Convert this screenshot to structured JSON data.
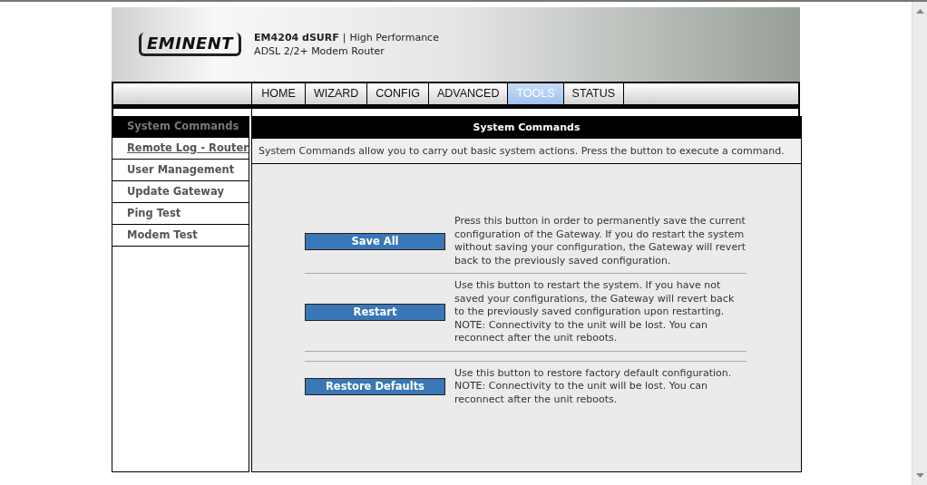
{
  "header": {
    "logo": "EMINENT",
    "product": "EM4204 dSURF",
    "separator": "|",
    "tagline": "High Performance",
    "subtitle": "ADSL 2/2+ Modem Router"
  },
  "tabs": [
    {
      "label": "HOME",
      "selected": false
    },
    {
      "label": "WIZARD",
      "selected": false
    },
    {
      "label": "CONFIG",
      "selected": false
    },
    {
      "label": "ADVANCED",
      "selected": false
    },
    {
      "label": "TOOLS",
      "selected": true
    },
    {
      "label": "STATUS",
      "selected": false
    }
  ],
  "sidebar": {
    "items": [
      {
        "label": "System Commands",
        "selected": true,
        "hovered": false
      },
      {
        "label": "Remote Log - Router",
        "selected": false,
        "hovered": true
      },
      {
        "label": "User Management",
        "selected": false,
        "hovered": false
      },
      {
        "label": "Update Gateway",
        "selected": false,
        "hovered": false
      },
      {
        "label": "Ping Test",
        "selected": false,
        "hovered": false
      },
      {
        "label": "Modem Test",
        "selected": false,
        "hovered": false
      }
    ]
  },
  "panel": {
    "title": "System Commands",
    "description": "System Commands allow you to carry out basic system actions. Press the button to execute a command.",
    "commands": [
      {
        "button": "Save All",
        "text": "Press this button in order to permanently save the current configuration of the Gateway. If you do restart the system without saving your configuration, the Gateway will revert back to the previously saved configuration."
      },
      {
        "button": "Restart",
        "text": "Use this button to restart the system. If you have not saved your configurations, the Gateway will revert back to the previously saved configuration upon restarting. NOTE: Connectivity to the unit will be lost. You can reconnect after the unit reboots."
      },
      {
        "button": "Restore Defaults",
        "text": "Use this button to restore factory default configuration. NOTE: Connectivity to the unit will be lost. You can reconnect after the unit reboots."
      }
    ]
  }
}
